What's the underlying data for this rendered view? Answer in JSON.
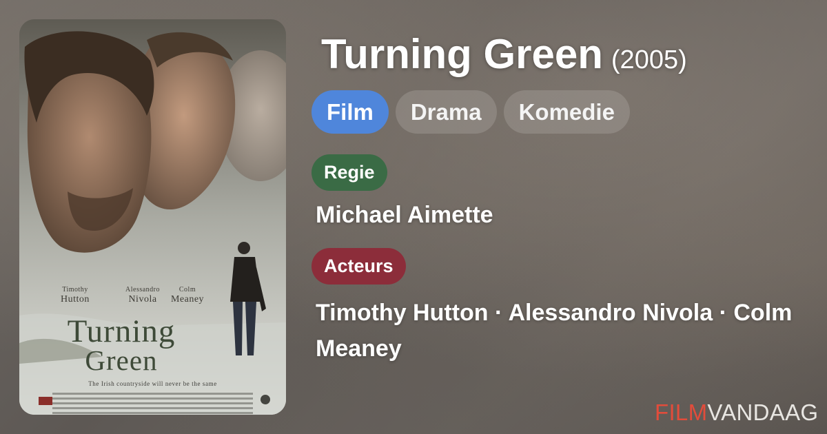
{
  "movie": {
    "title": "Turning Green",
    "year": "(2005)"
  },
  "genres": [
    {
      "label": "Film",
      "active": true
    },
    {
      "label": "Drama",
      "active": false
    },
    {
      "label": "Komedie",
      "active": false
    }
  ],
  "director_section": {
    "label": "Regie",
    "value": "Michael Aimette"
  },
  "cast_section": {
    "label": "Acteurs",
    "value": "Timothy Hutton · Alessandro Nivola · Colm Meaney"
  },
  "poster": {
    "cast": [
      {
        "first": "Timothy",
        "last": "Hutton"
      },
      {
        "first": "Alessandro",
        "last": "Nivola"
      },
      {
        "first": "Colm",
        "last": "Meaney"
      }
    ],
    "title_line1": "Turning",
    "title_line2": "Green",
    "tagline": "The Irish countryside will never be the same"
  },
  "brand": {
    "part1": "FILM",
    "part2": "VANDAAG"
  },
  "colors": {
    "film_chip": "#4f86db",
    "regie_label": "#3a6b45",
    "acteurs_label": "#8c2d3a",
    "brand_accent": "#e24c3b"
  }
}
